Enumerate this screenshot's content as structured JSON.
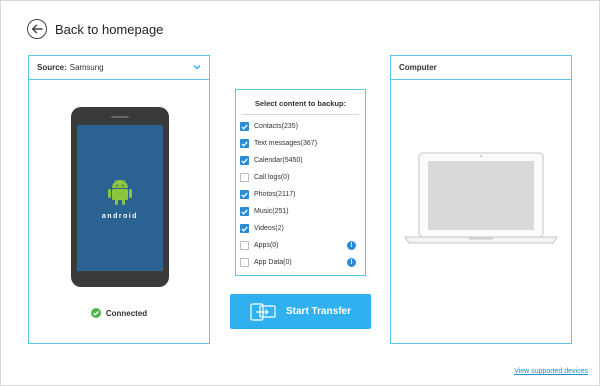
{
  "nav": {
    "back_label": "Back to homepage"
  },
  "source": {
    "label": "Source:",
    "device": "Samsung",
    "phone_brand_text": "android",
    "status": "Connected"
  },
  "content": {
    "title": "Select content to backup:",
    "items": [
      {
        "label": "Contacts(235)",
        "checked": true,
        "warning": false
      },
      {
        "label": "Text messages(367)",
        "checked": true,
        "warning": false
      },
      {
        "label": "Calendar(5450)",
        "checked": true,
        "warning": false
      },
      {
        "label": "Call logs(0)",
        "checked": false,
        "warning": false
      },
      {
        "label": "Photos(2117)",
        "checked": true,
        "warning": false
      },
      {
        "label": "Music(251)",
        "checked": true,
        "warning": false
      },
      {
        "label": "Videos(2)",
        "checked": true,
        "warning": false
      },
      {
        "label": "Apps(0)",
        "checked": false,
        "warning": true
      },
      {
        "label": "App Data(0)",
        "checked": false,
        "warning": true
      }
    ],
    "warning_glyph": "!"
  },
  "actions": {
    "start_label": "Start Transfer"
  },
  "destination": {
    "label": "Computer"
  },
  "footer": {
    "link_label": "View supported devices"
  },
  "colors": {
    "accent": "#2fb0ef",
    "panel_border": "#5bc8e8",
    "checkbox": "#2a8bd6",
    "connected_green": "#4cb84c",
    "android_green": "#8cc63f"
  }
}
